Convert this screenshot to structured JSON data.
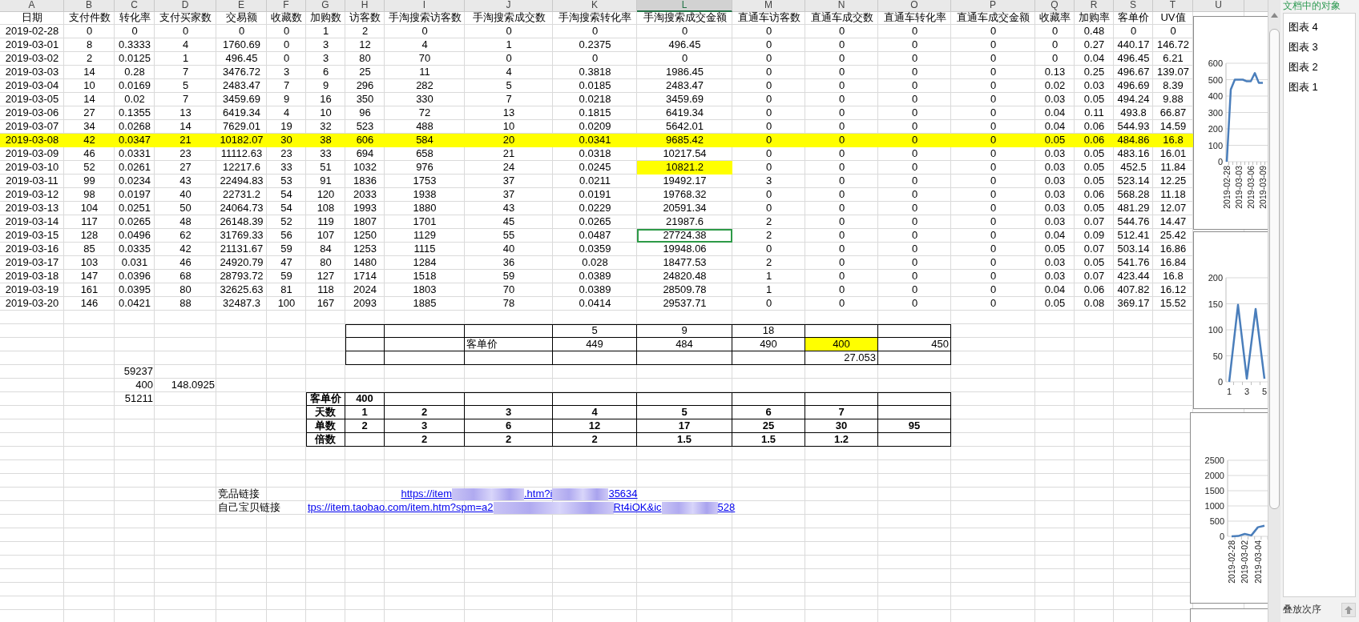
{
  "columns": [
    {
      "letter": "A",
      "header": "日期",
      "selected": false
    },
    {
      "letter": "B",
      "header": "支付件数",
      "selected": false
    },
    {
      "letter": "C",
      "header": "转化率",
      "selected": false
    },
    {
      "letter": "D",
      "header": "支付买家数",
      "selected": false
    },
    {
      "letter": "E",
      "header": "交易额",
      "selected": false
    },
    {
      "letter": "F",
      "header": "收藏数",
      "selected": false
    },
    {
      "letter": "G",
      "header": "加购数",
      "selected": false
    },
    {
      "letter": "H",
      "header": "访客数",
      "selected": false
    },
    {
      "letter": "I",
      "header": "手淘搜索访客数",
      "selected": false
    },
    {
      "letter": "J",
      "header": "手淘搜索成交数",
      "selected": false
    },
    {
      "letter": "K",
      "header": "手淘搜索转化率",
      "selected": false
    },
    {
      "letter": "L",
      "header": "手淘搜索成交金额",
      "selected": true
    },
    {
      "letter": "M",
      "header": "直通车访客数",
      "selected": false
    },
    {
      "letter": "N",
      "header": "直通车成交数",
      "selected": false
    },
    {
      "letter": "O",
      "header": "直通车转化率",
      "selected": false
    },
    {
      "letter": "P",
      "header": "直通车成交金额",
      "selected": false
    },
    {
      "letter": "Q",
      "header": "收藏率",
      "selected": false
    },
    {
      "letter": "R",
      "header": "加购率",
      "selected": false
    },
    {
      "letter": "S",
      "header": "客单价",
      "selected": false
    },
    {
      "letter": "T",
      "header": "UV值",
      "selected": false
    },
    {
      "letter": "U",
      "selected": false
    }
  ],
  "rows": [
    {
      "highlighted": false,
      "selected_column_cell_highlighted": false,
      "selected_column_cell_active": false,
      "cells": [
        "2019-02-28",
        "0",
        "0",
        "0",
        "0",
        "0",
        "1",
        "2",
        "0",
        "0",
        "0",
        "0",
        "0",
        "0",
        "0",
        "0",
        "0",
        "0.48",
        "0",
        "0"
      ]
    },
    {
      "highlighted": false,
      "selected_column_cell_highlighted": false,
      "selected_column_cell_active": false,
      "cells": [
        "2019-03-01",
        "8",
        "0.3333",
        "4",
        "1760.69",
        "0",
        "3",
        "12",
        "4",
        "1",
        "0.2375",
        "496.45",
        "0",
        "0",
        "0",
        "0",
        "0",
        "0.27",
        "440.17",
        "146.72"
      ]
    },
    {
      "highlighted": false,
      "selected_column_cell_highlighted": false,
      "selected_column_cell_active": false,
      "cells": [
        "2019-03-02",
        "2",
        "0.0125",
        "1",
        "496.45",
        "0",
        "3",
        "80",
        "70",
        "0",
        "0",
        "0",
        "0",
        "0",
        "0",
        "0",
        "0",
        "0.04",
        "496.45",
        "6.21"
      ]
    },
    {
      "highlighted": false,
      "selected_column_cell_highlighted": false,
      "selected_column_cell_active": false,
      "cells": [
        "2019-03-03",
        "14",
        "0.28",
        "7",
        "3476.72",
        "3",
        "6",
        "25",
        "11",
        "4",
        "0.3818",
        "1986.45",
        "0",
        "0",
        "0",
        "0",
        "0.13",
        "0.25",
        "496.67",
        "139.07"
      ]
    },
    {
      "highlighted": false,
      "selected_column_cell_highlighted": false,
      "selected_column_cell_active": false,
      "cells": [
        "2019-03-04",
        "10",
        "0.0169",
        "5",
        "2483.47",
        "7",
        "9",
        "296",
        "282",
        "5",
        "0.0185",
        "2483.47",
        "0",
        "0",
        "0",
        "0",
        "0.02",
        "0.03",
        "496.69",
        "8.39"
      ]
    },
    {
      "highlighted": false,
      "selected_column_cell_highlighted": false,
      "selected_column_cell_active": false,
      "cells": [
        "2019-03-05",
        "14",
        "0.02",
        "7",
        "3459.69",
        "9",
        "16",
        "350",
        "330",
        "7",
        "0.0218",
        "3459.69",
        "0",
        "0",
        "0",
        "0",
        "0.03",
        "0.05",
        "494.24",
        "9.88"
      ]
    },
    {
      "highlighted": false,
      "selected_column_cell_highlighted": false,
      "selected_column_cell_active": false,
      "cells": [
        "2019-03-06",
        "27",
        "0.1355",
        "13",
        "6419.34",
        "4",
        "10",
        "96",
        "72",
        "13",
        "0.1815",
        "6419.34",
        "0",
        "0",
        "0",
        "0",
        "0.04",
        "0.11",
        "493.8",
        "66.87"
      ]
    },
    {
      "highlighted": false,
      "selected_column_cell_highlighted": false,
      "selected_column_cell_active": false,
      "cells": [
        "2019-03-07",
        "34",
        "0.0268",
        "14",
        "7629.01",
        "19",
        "32",
        "523",
        "488",
        "10",
        "0.0209",
        "5642.01",
        "0",
        "0",
        "0",
        "0",
        "0.04",
        "0.06",
        "544.93",
        "14.59"
      ]
    },
    {
      "highlighted": true,
      "selected_column_cell_highlighted": false,
      "selected_column_cell_active": false,
      "cells": [
        "2019-03-08",
        "42",
        "0.0347",
        "21",
        "10182.07",
        "30",
        "38",
        "606",
        "584",
        "20",
        "0.0341",
        "9685.42",
        "0",
        "0",
        "0",
        "0",
        "0.05",
        "0.06",
        "484.86",
        "16.8"
      ]
    },
    {
      "highlighted": false,
      "selected_column_cell_highlighted": false,
      "selected_column_cell_active": false,
      "cells": [
        "2019-03-09",
        "46",
        "0.0331",
        "23",
        "11112.63",
        "23",
        "33",
        "694",
        "658",
        "21",
        "0.0318",
        "10217.54",
        "0",
        "0",
        "0",
        "0",
        "0.03",
        "0.05",
        "483.16",
        "16.01"
      ]
    },
    {
      "highlighted": false,
      "selected_column_cell_highlighted": true,
      "selected_column_cell_active": false,
      "cells": [
        "2019-03-10",
        "52",
        "0.0261",
        "27",
        "12217.6",
        "33",
        "51",
        "1032",
        "976",
        "24",
        "0.0245",
        "10821.2",
        "0",
        "0",
        "0",
        "0",
        "0.03",
        "0.05",
        "452.5",
        "11.84"
      ]
    },
    {
      "highlighted": false,
      "selected_column_cell_highlighted": false,
      "selected_column_cell_active": false,
      "cells": [
        "2019-03-11",
        "99",
        "0.0234",
        "43",
        "22494.83",
        "53",
        "91",
        "1836",
        "1753",
        "37",
        "0.0211",
        "19492.17",
        "3",
        "0",
        "0",
        "0",
        "0.03",
        "0.05",
        "523.14",
        "12.25"
      ]
    },
    {
      "highlighted": false,
      "selected_column_cell_highlighted": false,
      "selected_column_cell_active": false,
      "cells": [
        "2019-03-12",
        "98",
        "0.0197",
        "40",
        "22731.2",
        "54",
        "120",
        "2033",
        "1938",
        "37",
        "0.0191",
        "19768.32",
        "0",
        "0",
        "0",
        "0",
        "0.03",
        "0.06",
        "568.28",
        "11.18"
      ]
    },
    {
      "highlighted": false,
      "selected_column_cell_highlighted": false,
      "selected_column_cell_active": false,
      "cells": [
        "2019-03-13",
        "104",
        "0.0251",
        "50",
        "24064.73",
        "54",
        "108",
        "1993",
        "1880",
        "43",
        "0.0229",
        "20591.34",
        "0",
        "0",
        "0",
        "0",
        "0.03",
        "0.05",
        "481.29",
        "12.07"
      ]
    },
    {
      "highlighted": false,
      "selected_column_cell_highlighted": false,
      "selected_column_cell_active": false,
      "cells": [
        "2019-03-14",
        "117",
        "0.0265",
        "48",
        "26148.39",
        "52",
        "119",
        "1807",
        "1701",
        "45",
        "0.0265",
        "21987.6",
        "2",
        "0",
        "0",
        "0",
        "0.03",
        "0.07",
        "544.76",
        "14.47"
      ]
    },
    {
      "highlighted": false,
      "selected_column_cell_highlighted": false,
      "selected_column_cell_active": true,
      "cells": [
        "2019-03-15",
        "128",
        "0.0496",
        "62",
        "31769.33",
        "56",
        "107",
        "1250",
        "1129",
        "55",
        "0.0487",
        "27724.38",
        "2",
        "0",
        "0",
        "0",
        "0.04",
        "0.09",
        "512.41",
        "25.42"
      ]
    },
    {
      "highlighted": false,
      "selected_column_cell_highlighted": false,
      "selected_column_cell_active": false,
      "cells": [
        "2019-03-16",
        "85",
        "0.0335",
        "42",
        "21131.67",
        "59",
        "84",
        "1253",
        "1115",
        "40",
        "0.0359",
        "19948.06",
        "0",
        "0",
        "0",
        "0",
        "0.05",
        "0.07",
        "503.14",
        "16.86"
      ]
    },
    {
      "highlighted": false,
      "selected_column_cell_highlighted": false,
      "selected_column_cell_active": false,
      "cells": [
        "2019-03-17",
        "103",
        "0.031",
        "46",
        "24920.79",
        "47",
        "80",
        "1480",
        "1284",
        "36",
        "0.028",
        "18477.53",
        "2",
        "0",
        "0",
        "0",
        "0.03",
        "0.05",
        "541.76",
        "16.84"
      ]
    },
    {
      "highlighted": false,
      "selected_column_cell_highlighted": false,
      "selected_column_cell_active": false,
      "cells": [
        "2019-03-18",
        "147",
        "0.0396",
        "68",
        "28793.72",
        "59",
        "127",
        "1714",
        "1518",
        "59",
        "0.0389",
        "24820.48",
        "1",
        "0",
        "0",
        "0",
        "0.03",
        "0.07",
        "423.44",
        "16.8"
      ]
    },
    {
      "highlighted": false,
      "selected_column_cell_highlighted": false,
      "selected_column_cell_active": false,
      "cells": [
        "2019-03-19",
        "161",
        "0.0395",
        "80",
        "32625.63",
        "81",
        "118",
        "2024",
        "1803",
        "70",
        "0.0389",
        "28509.78",
        "1",
        "0",
        "0",
        "0",
        "0.04",
        "0.06",
        "407.82",
        "16.12"
      ]
    },
    {
      "highlighted": false,
      "selected_column_cell_highlighted": false,
      "selected_column_cell_active": false,
      "cells": [
        "2019-03-20",
        "146",
        "0.0421",
        "88",
        "32487.3",
        "100",
        "167",
        "2093",
        "1885",
        "78",
        "0.0414",
        "29537.71",
        "0",
        "0",
        "0",
        "0",
        "0.05",
        "0.08",
        "369.17",
        "15.52"
      ]
    }
  ],
  "price_table": {
    "rows": [
      {
        "cells": [
          null,
          null,
          null,
          {
            "text": "5",
            "highlighted": false
          },
          {
            "text": "9",
            "highlighted": false
          },
          {
            "text": "18",
            "highlighted": false
          },
          null,
          null
        ]
      },
      {
        "cells": [
          null,
          null,
          {
            "text": "客单价",
            "highlighted": false
          },
          {
            "text": "449",
            "highlighted": false
          },
          {
            "text": "484",
            "highlighted": false
          },
          {
            "text": "490",
            "highlighted": false
          },
          {
            "text": "400",
            "highlighted": true
          },
          {
            "text": "450",
            "highlighted": false
          }
        ]
      },
      {
        "cells": [
          null,
          null,
          null,
          null,
          null,
          null,
          {
            "text": "27.053",
            "highlighted": false
          },
          null
        ]
      }
    ]
  },
  "loose_values": [
    {
      "cells": [
        "59237"
      ]
    },
    {
      "cells": [
        "400",
        "148.0925"
      ]
    },
    {
      "cells": [
        "51211"
      ]
    }
  ],
  "plan_table": {
    "rows": [
      {
        "cells": [
          "客单价",
          "400",
          null,
          null,
          null,
          null,
          null,
          null,
          null
        ]
      },
      {
        "cells": [
          "天数",
          "1",
          "2",
          "3",
          "4",
          "5",
          "6",
          "7",
          null
        ]
      },
      {
        "cells": [
          "单数",
          "2",
          "3",
          "6",
          "12",
          "17",
          "25",
          "30",
          "95"
        ]
      },
      {
        "cells": [
          "倍数",
          null,
          "2",
          "2",
          "2",
          "1.5",
          "1.5",
          "1.2",
          null
        ]
      }
    ]
  },
  "links": [
    {
      "label": "竞品链接",
      "parts": [
        {
          "kind": "text",
          "text": "https://item"
        },
        {
          "kind": "mosaic"
        },
        {
          "kind": "text",
          "text": ".htm?i"
        },
        {
          "kind": "mosaic"
        },
        {
          "kind": "text",
          "text": "35634"
        }
      ]
    },
    {
      "label": "自己宝贝链接",
      "parts": [
        {
          "kind": "text",
          "text": "tps://item.taobao.com/item.htm?spm=a2"
        },
        {
          "kind": "mosaic"
        },
        {
          "kind": "text",
          "text": "Rt4iOK&ic"
        },
        {
          "kind": "mosaic"
        },
        {
          "kind": "text",
          "text": "528"
        }
      ]
    }
  ],
  "charts": [
    {
      "chart_data": {
        "type": "line",
        "categories": [
          "2019-02-28",
          null,
          null,
          "2019-03-03",
          null,
          null,
          "2019-03-06",
          null,
          null,
          "2019-03-09"
        ],
        "grid": true,
        "series": [
          {
            "color": "#4a7ebb",
            "values": [
              0,
              440,
              500,
              500,
              500,
              490,
              490,
              540,
              480,
              480
            ]
          }
        ],
        "ylim": [
          0,
          600
        ],
        "yticks": [
          0,
          100,
          200,
          300,
          400,
          500,
          600
        ]
      }
    },
    {
      "chart_data": {
        "type": "line",
        "categories": [
          "1",
          null,
          "3",
          null,
          "5"
        ],
        "grid": true,
        "series": [
          {
            "color": "#4a7ebb",
            "values": [
              0,
              148,
              6,
              140,
              6
            ]
          }
        ],
        "ylim": [
          0,
          200
        ],
        "yticks": [
          0,
          50,
          100,
          150,
          200
        ]
      }
    },
    {
      "chart_data": {
        "type": "line",
        "categories": [
          "2019-02-28",
          null,
          "2019-03-02",
          null,
          "2019-03-04",
          null
        ],
        "grid": true,
        "series": [
          {
            "color": "#4a7ebb",
            "values": [
              0,
              10,
              80,
              30,
              300,
              350
            ]
          }
        ],
        "ylim": [
          0,
          2500
        ],
        "yticks": [
          0,
          500,
          1000,
          1500,
          2000,
          2500
        ]
      }
    }
  ],
  "objects_panel": {
    "title": "文档中的对象",
    "items": [
      {
        "label": "图表 4",
        "selected": false
      },
      {
        "label": "图表 3",
        "selected": false
      },
      {
        "label": "图表 2",
        "selected": false
      },
      {
        "label": "图表 1",
        "selected": false
      }
    ],
    "footer_label": "叠放次序"
  }
}
